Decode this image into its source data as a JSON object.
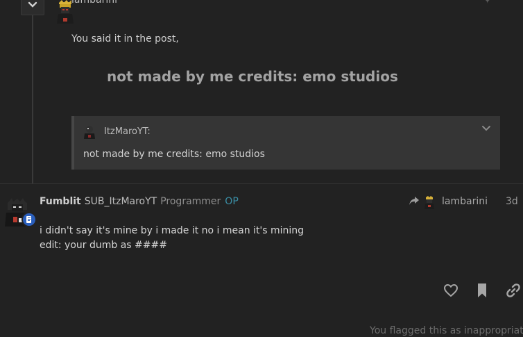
{
  "top_post": {
    "username": "lambarini",
    "reply_text": "You said it in the post,",
    "big_quote": "not made by me credits: emo studios"
  },
  "quote": {
    "username": "ItzMaroYT:",
    "text": "not made by me credits: emo studios"
  },
  "post": {
    "username": "Fumblit",
    "full_name": "SUB_ItzMaroYT",
    "user_title": "Programmer",
    "op_badge": "OP",
    "reply_to_user": "lambarini",
    "date": "3d",
    "body_line1": "i didn't say it's mine by i made it no i mean it's mining",
    "body_line2": "edit: your dumb as ####"
  },
  "footer": {
    "flag_notice": "You flagged this as inappropriate"
  },
  "icons": {
    "toggle": "chevron-down-icon",
    "quote_toggle": "chevron-down-icon",
    "reply_to": "share-arrow-icon",
    "like": "heart-icon",
    "bookmark": "bookmark-icon",
    "link": "link-icon",
    "flair": "scroll-icon"
  },
  "colors": {
    "background": "#222222",
    "op_badge": "#3b8fa6",
    "flair": "#2a5fbd"
  }
}
